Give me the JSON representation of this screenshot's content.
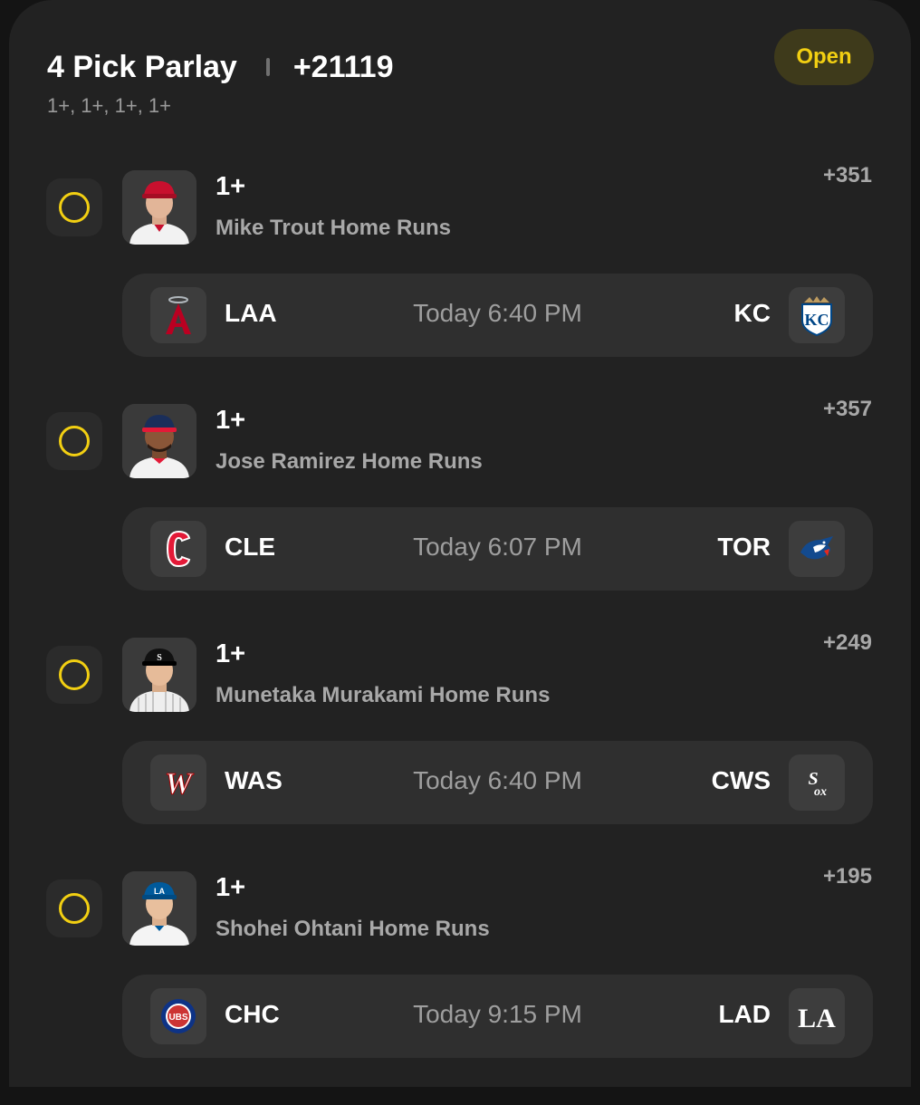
{
  "parlay": {
    "title": "4 Pick Parlay",
    "odds": "+21119",
    "subtitle": "1+, 1+, 1+, 1+",
    "status": "Open"
  },
  "colors": {
    "accent": "#f2cf12",
    "card": "#222222",
    "game_row": "#2f2f2f"
  },
  "legs": [
    {
      "line": "1+",
      "market": "Mike Trout Home Runs",
      "odds": "+351",
      "avatar_icon": "player-headshot-angels",
      "game": {
        "home": "LAA",
        "time": "Today 6:40 PM",
        "away": "KC",
        "home_icon": "angels-logo-icon",
        "away_icon": "royals-logo-icon"
      }
    },
    {
      "line": "1+",
      "market": "Jose Ramirez Home Runs",
      "odds": "+357",
      "avatar_icon": "player-headshot-guardians",
      "game": {
        "home": "CLE",
        "time": "Today 6:07 PM",
        "away": "TOR",
        "home_icon": "guardians-logo-icon",
        "away_icon": "blue-jays-logo-icon"
      }
    },
    {
      "line": "1+",
      "market": "Munetaka Murakami Home Runs",
      "odds": "+249",
      "avatar_icon": "player-headshot-white-sox",
      "game": {
        "home": "WAS",
        "time": "Today 6:40 PM",
        "away": "CWS",
        "home_icon": "nationals-logo-icon",
        "away_icon": "white-sox-logo-icon"
      }
    },
    {
      "line": "1+",
      "market": "Shohei Ohtani Home Runs",
      "odds": "+195",
      "avatar_icon": "player-headshot-dodgers",
      "game": {
        "home": "CHC",
        "time": "Today 9:15 PM",
        "away": "LAD",
        "home_icon": "cubs-logo-icon",
        "away_icon": "dodgers-logo-icon"
      }
    }
  ]
}
